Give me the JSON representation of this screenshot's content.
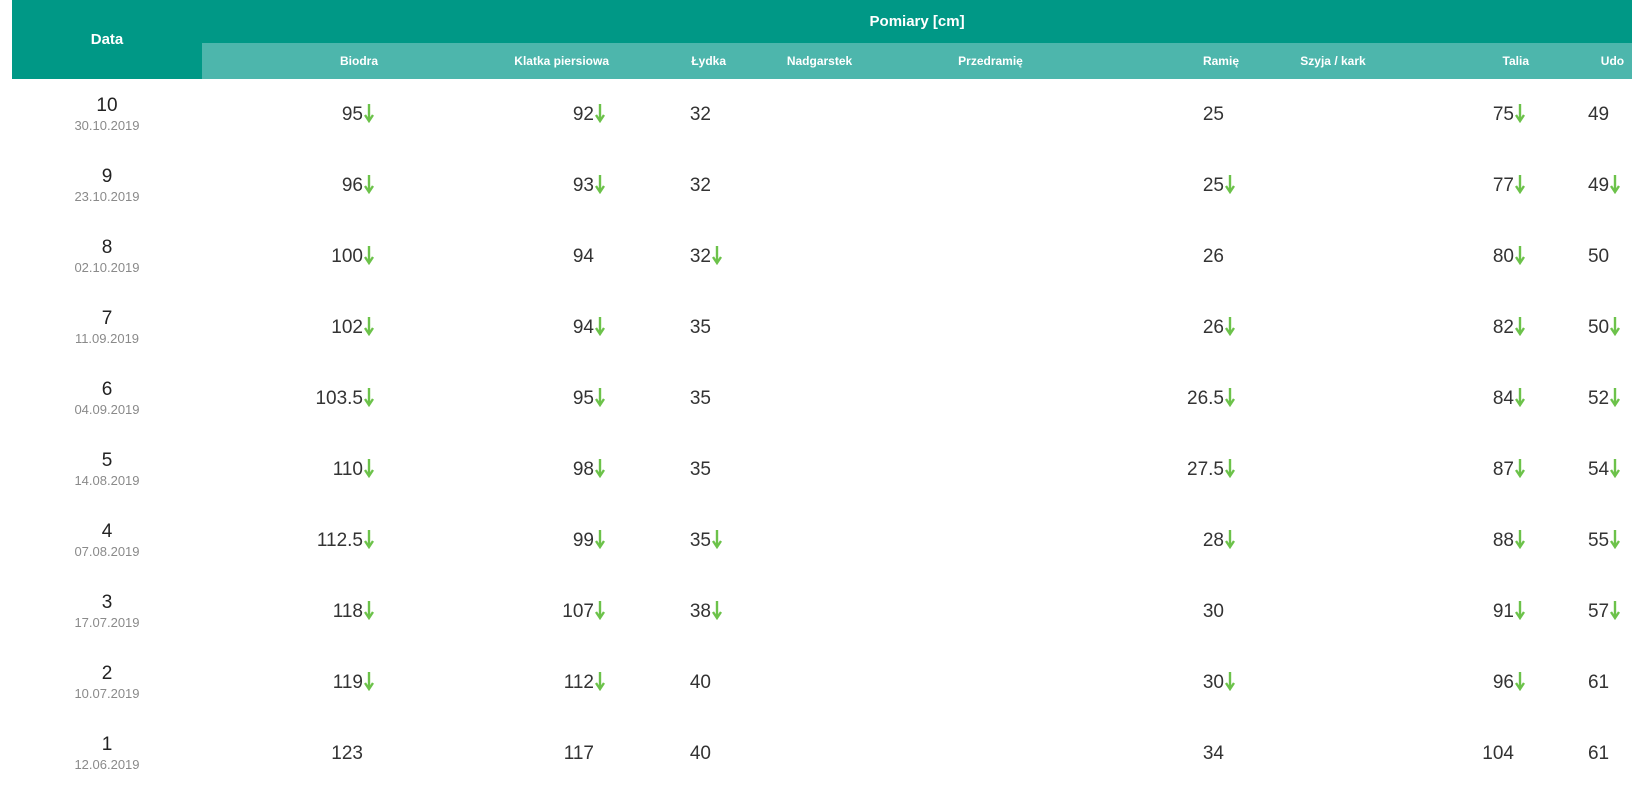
{
  "header": {
    "date_label": "Data",
    "group_label": "Pomiary [cm]",
    "columns": [
      "Biodra",
      "Klatka piersiowa",
      "Łydka",
      "Nadgarstek",
      "Przedramię",
      "Ramię",
      "Szyja / kark",
      "Talia",
      "Udo"
    ]
  },
  "colors": {
    "header_dark": "#009886",
    "header_light": "#4db6ac",
    "arrow_down": "#6cc24a"
  },
  "icons": {
    "decrease": "arrow-down-icon"
  },
  "rows": [
    {
      "n": "10",
      "date": "30.10.2019",
      "cells": [
        [
          "95",
          true
        ],
        [
          "92",
          true
        ],
        [
          "32",
          false
        ],
        [
          "",
          false
        ],
        [
          "",
          false
        ],
        [
          "25",
          false
        ],
        [
          "",
          false
        ],
        [
          "75",
          true
        ],
        [
          "49",
          false
        ]
      ]
    },
    {
      "n": "9",
      "date": "23.10.2019",
      "cells": [
        [
          "96",
          true
        ],
        [
          "93",
          true
        ],
        [
          "32",
          false
        ],
        [
          "",
          false
        ],
        [
          "",
          false
        ],
        [
          "25",
          true
        ],
        [
          "",
          false
        ],
        [
          "77",
          true
        ],
        [
          "49",
          true
        ]
      ]
    },
    {
      "n": "8",
      "date": "02.10.2019",
      "cells": [
        [
          "100",
          true
        ],
        [
          "94",
          false
        ],
        [
          "32",
          true
        ],
        [
          "",
          false
        ],
        [
          "",
          false
        ],
        [
          "26",
          false
        ],
        [
          "",
          false
        ],
        [
          "80",
          true
        ],
        [
          "50",
          false
        ]
      ]
    },
    {
      "n": "7",
      "date": "11.09.2019",
      "cells": [
        [
          "102",
          true
        ],
        [
          "94",
          true
        ],
        [
          "35",
          false
        ],
        [
          "",
          false
        ],
        [
          "",
          false
        ],
        [
          "26",
          true
        ],
        [
          "",
          false
        ],
        [
          "82",
          true
        ],
        [
          "50",
          true
        ]
      ]
    },
    {
      "n": "6",
      "date": "04.09.2019",
      "cells": [
        [
          "103.5",
          true
        ],
        [
          "95",
          true
        ],
        [
          "35",
          false
        ],
        [
          "",
          false
        ],
        [
          "",
          false
        ],
        [
          "26.5",
          true
        ],
        [
          "",
          false
        ],
        [
          "84",
          true
        ],
        [
          "52",
          true
        ]
      ]
    },
    {
      "n": "5",
      "date": "14.08.2019",
      "cells": [
        [
          "110",
          true
        ],
        [
          "98",
          true
        ],
        [
          "35",
          false
        ],
        [
          "",
          false
        ],
        [
          "",
          false
        ],
        [
          "27.5",
          true
        ],
        [
          "",
          false
        ],
        [
          "87",
          true
        ],
        [
          "54",
          true
        ]
      ]
    },
    {
      "n": "4",
      "date": "07.08.2019",
      "cells": [
        [
          "112.5",
          true
        ],
        [
          "99",
          true
        ],
        [
          "35",
          true
        ],
        [
          "",
          false
        ],
        [
          "",
          false
        ],
        [
          "28",
          true
        ],
        [
          "",
          false
        ],
        [
          "88",
          true
        ],
        [
          "55",
          true
        ]
      ]
    },
    {
      "n": "3",
      "date": "17.07.2019",
      "cells": [
        [
          "118",
          true
        ],
        [
          "107",
          true
        ],
        [
          "38",
          true
        ],
        [
          "",
          false
        ],
        [
          "",
          false
        ],
        [
          "30",
          false
        ],
        [
          "",
          false
        ],
        [
          "91",
          true
        ],
        [
          "57",
          true
        ]
      ]
    },
    {
      "n": "2",
      "date": "10.07.2019",
      "cells": [
        [
          "119",
          true
        ],
        [
          "112",
          true
        ],
        [
          "40",
          false
        ],
        [
          "",
          false
        ],
        [
          "",
          false
        ],
        [
          "30",
          true
        ],
        [
          "",
          false
        ],
        [
          "96",
          true
        ],
        [
          "61",
          false
        ]
      ]
    },
    {
      "n": "1",
      "date": "12.06.2019",
      "cells": [
        [
          "123",
          false
        ],
        [
          "117",
          false
        ],
        [
          "40",
          false
        ],
        [
          "",
          false
        ],
        [
          "",
          false
        ],
        [
          "34",
          false
        ],
        [
          "",
          false
        ],
        [
          "104",
          false
        ],
        [
          "61",
          false
        ]
      ]
    }
  ]
}
